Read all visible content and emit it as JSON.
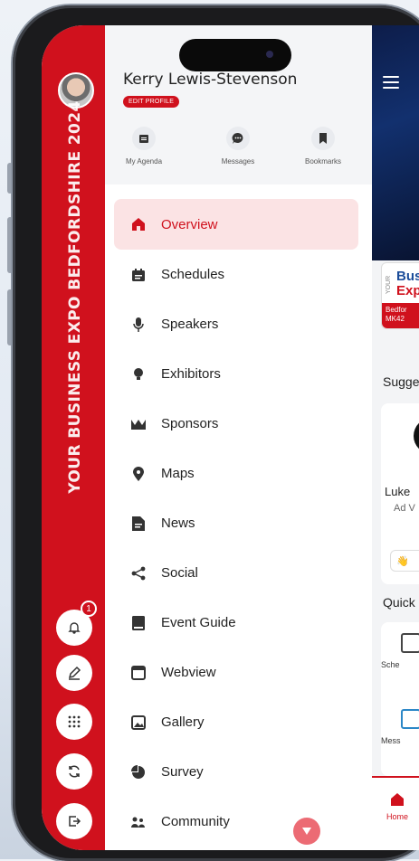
{
  "rail": {
    "event_title": "YOUR BUSINESS EXPO BEDFORDSHIRE 2024",
    "notification_count": "1",
    "buttons": [
      "notifications-icon",
      "edit-icon",
      "apps-grid-icon",
      "refresh-icon",
      "logout-icon"
    ]
  },
  "profile": {
    "name": "Kerry Lewis-Stevenson",
    "edit_label": "EDIT PROFILE"
  },
  "quick_links": [
    {
      "label": "My Agenda",
      "icon": "agenda-icon"
    },
    {
      "label": "Messages",
      "icon": "chat-icon"
    },
    {
      "label": "Bookmarks",
      "icon": "bookmark-icon"
    }
  ],
  "menu": [
    {
      "label": "Overview",
      "icon": "home-icon",
      "active": true
    },
    {
      "label": "Schedules",
      "icon": "calendar-icon"
    },
    {
      "label": "Speakers",
      "icon": "microphone-icon"
    },
    {
      "label": "Exhibitors",
      "icon": "lightbulb-icon"
    },
    {
      "label": "Sponsors",
      "icon": "crown-icon"
    },
    {
      "label": "Maps",
      "icon": "map-pin-icon"
    },
    {
      "label": "News",
      "icon": "news-icon"
    },
    {
      "label": "Social",
      "icon": "share-icon"
    },
    {
      "label": "Event Guide",
      "icon": "book-icon"
    },
    {
      "label": "Webview",
      "icon": "browser-icon"
    },
    {
      "label": "Gallery",
      "icon": "image-icon"
    },
    {
      "label": "Survey",
      "icon": "pie-chart-icon"
    },
    {
      "label": "Community",
      "icon": "people-icon"
    }
  ],
  "page": {
    "logo_your": "YOUR",
    "logo_line1": "Bus",
    "logo_line2": "Exp",
    "logo_location_1": "Bedfor",
    "logo_location_2": "MK42",
    "suggested_heading": "Sugge",
    "suggested_name": "Luke",
    "suggested_role": "Ad V",
    "quick_heading": "Quick",
    "quick_1": "Sche",
    "quick_2": "Mess",
    "tab_home": "Home"
  },
  "colors": {
    "brand_red": "#d0111d",
    "active_bg": "#fbe3e4"
  }
}
